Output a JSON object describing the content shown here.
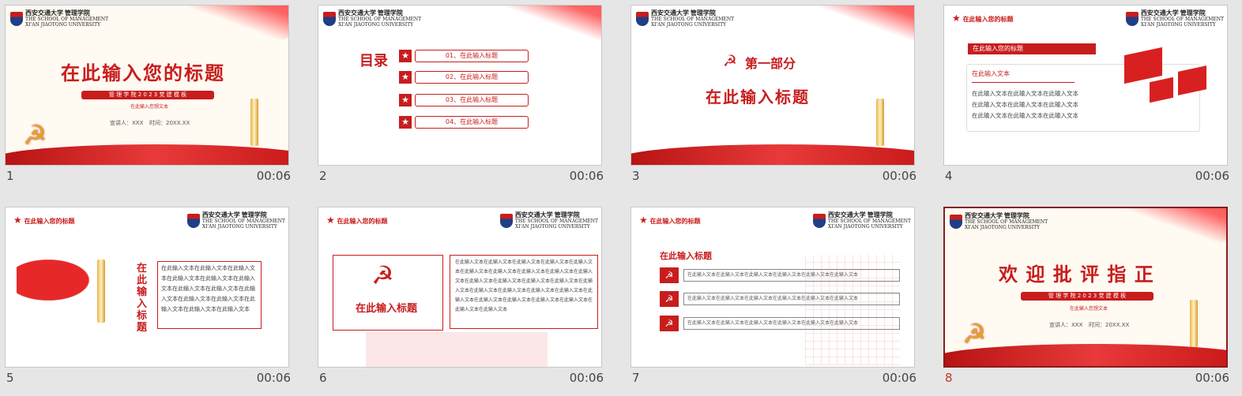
{
  "slides": [
    {
      "num": "1",
      "dur": "00:06",
      "logo_cn": "西安交通大学",
      "logo_school": "管理学院",
      "logo_en1": "THE SCHOOL OF MANAGEMENT",
      "logo_en2": "XI'AN JIAOTONG UNIVERSITY",
      "title": "在此输入您的标题",
      "banner": "管 理 学 院 2 0 2 3 党 建 模 板",
      "sub": "在此输入您想文本",
      "presenter": "宣讲人：XXX",
      "time": "时间：20XX.XX"
    },
    {
      "num": "2",
      "dur": "00:06",
      "logo_cn": "西安交通大学",
      "logo_school": "管理学院",
      "logo_en1": "THE SCHOOL OF MANAGEMENT",
      "logo_en2": "XI'AN JIAOTONG UNIVERSITY",
      "toc_title": "目录",
      "items": [
        "01、在此输入标题",
        "02、在此输入标题",
        "03、在此输入标题",
        "04、在此输入标题"
      ]
    },
    {
      "num": "3",
      "dur": "00:06",
      "logo_cn": "西安交通大学",
      "logo_school": "管理学院",
      "logo_en1": "THE SCHOOL OF MANAGEMENT",
      "logo_en2": "XI'AN JIAOTONG UNIVERSITY",
      "part": "第一部分",
      "title": "在此输入标题"
    },
    {
      "num": "4",
      "dur": "00:06",
      "logo_cn": "西安交通大学",
      "logo_school": "管理学院",
      "logo_en1": "THE SCHOOL OF MANAGEMENT",
      "logo_en2": "XI'AN JIAOTONG UNIVERSITY",
      "header": "在此输入您的标题",
      "bar": "在此输入您的标题",
      "box_title": "在此输入文本",
      "lines": [
        "在此输入文本在此输入文本在此输入文本",
        "在此输入文本在此输入文本在此输入文本",
        "在此输入文本在此输入文本在此输入文本"
      ]
    },
    {
      "num": "5",
      "dur": "00:06",
      "logo_cn": "西安交通大学",
      "logo_school": "管理学院",
      "logo_en1": "THE SCHOOL OF MANAGEMENT",
      "logo_en2": "XI'AN JIAOTONG UNIVERSITY",
      "header": "在此输入您的标题",
      "vertical": "在此输入标题",
      "body": "在此输入文本在此输入文本在此输入文本在此输入文本在此输入文本在此输入文本在此输入文本在此输入文本在此输入文本在此输入文本在此输入文本在此输入文本在此输入文本在此输入文本"
    },
    {
      "num": "6",
      "dur": "00:06",
      "logo_cn": "西安交通大学",
      "logo_school": "管理学院",
      "logo_en1": "THE SCHOOL OF MANAGEMENT",
      "logo_en2": "XI'AN JIAOTONG UNIVERSITY",
      "header": "在此输入您的标题",
      "left_title": "在此输入标题",
      "body": "在此输入文本在此输入文本在此输入文本在此输入文本在此输入文本在此输入文本在此输入文本在此输入文本在此输入文本在此输入文本在此输入文本在此输入文本在此输入文本在此输入文本在此输入文本在此输入文本在此输入文本在此输入文本在此输入文本在此输入文本在此输入文本在此输入文本在此输入文本在此输入文本在此输入文本在此输入文本"
    },
    {
      "num": "7",
      "dur": "00:06",
      "logo_cn": "西安交通大学",
      "logo_school": "管理学院",
      "logo_en1": "THE SCHOOL OF MANAGEMENT",
      "logo_en2": "XI'AN JIAOTONG UNIVERSITY",
      "header": "在此输入您的标题",
      "section": "在此输入标题",
      "rows": [
        "在此输入文本在此输入文本在此输入文本在此输入文本在此输入文本在此输入文本",
        "在此输入文本在此输入文本在此输入文本在此输入文本在此输入文本在此输入文本",
        "在此输入文本在此输入文本在此输入文本在此输入文本在此输入文本在此输入文本"
      ]
    },
    {
      "num": "8",
      "dur": "00:06",
      "logo_cn": "西安交通大学",
      "logo_school": "管理学院",
      "logo_en1": "THE SCHOOL OF MANAGEMENT",
      "logo_en2": "XI'AN JIAOTONG UNIVERSITY",
      "title": "欢 迎 批 评 指 正",
      "banner": "管 理 学 院 2 0 2 3 党 建 模 板",
      "sub": "在此输入您想文本",
      "presenter": "宣讲人：XXX",
      "time": "时间：20XX.XX"
    }
  ],
  "colors": {
    "accent": "#c81d1d",
    "selected_border": "#8b1a1a"
  }
}
